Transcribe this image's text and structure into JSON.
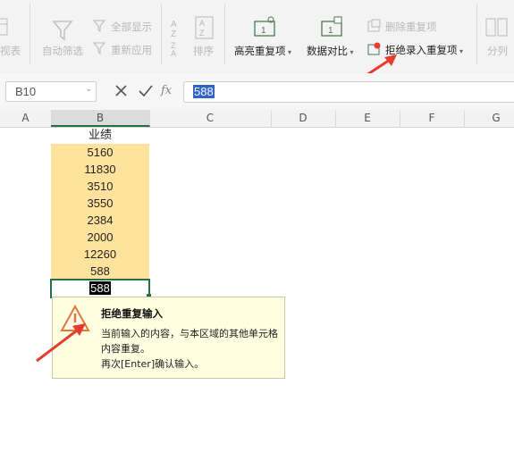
{
  "ribbon": {
    "pivot_label": "视表",
    "auto_filter_label": "自动筛选",
    "show_all_label": "全部显示",
    "reapply_label": "重新应用",
    "sort_label": "排序",
    "highlight_dup_label": "高亮重复项",
    "compare_label": "数据对比",
    "delete_dup_label": "删除重复项",
    "reject_dup_label": "拒绝录入重复项",
    "split_label": "分列"
  },
  "formula_bar": {
    "cell_ref": "B10",
    "fx_label": "fx",
    "value": "588"
  },
  "columns": [
    "A",
    "B",
    "C",
    "D",
    "E",
    "F",
    "G"
  ],
  "sheet": {
    "header": "业绩",
    "values": [
      "5160",
      "11830",
      "3510",
      "3550",
      "2384",
      "2000",
      "12260",
      "588"
    ],
    "active_value": "588"
  },
  "tooltip": {
    "title": "拒绝重复输入",
    "line1": "当前输入的内容，与本区域的其他单元格内容重复。",
    "line2": "再次[Enter]确认输入。"
  },
  "colors": {
    "highlight": "#ffe39c",
    "active_border": "#217346",
    "arrow": "#e53c2e",
    "tooltip_bg": "#ffffe1"
  }
}
